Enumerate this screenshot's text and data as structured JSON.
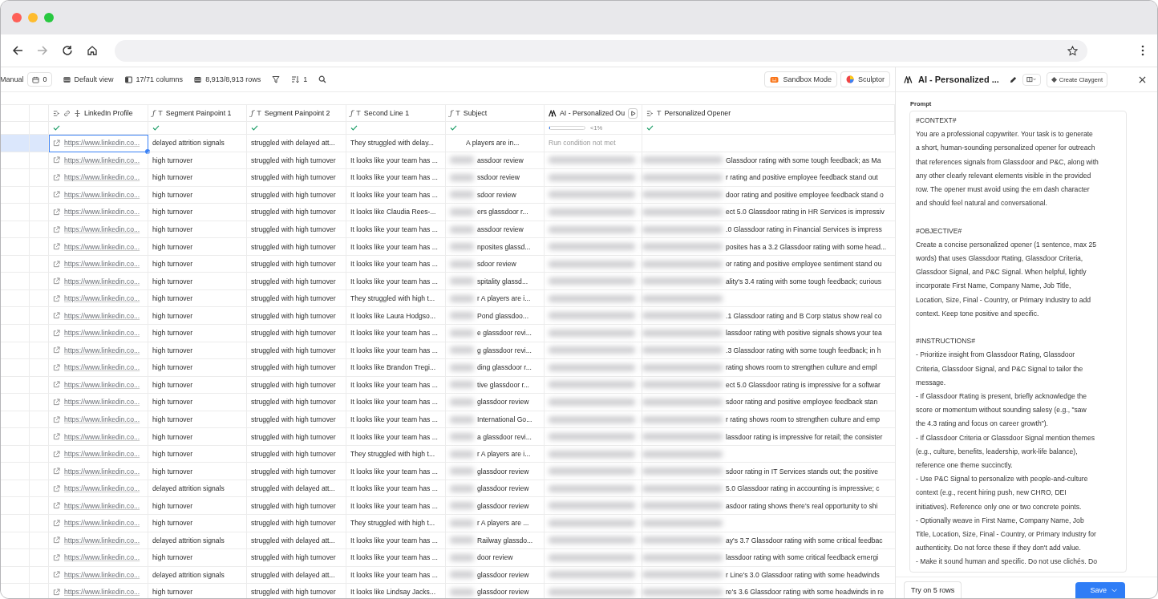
{
  "toolbar": {
    "view_mode": "Manual",
    "count": "0",
    "view": "Default view",
    "columns": "17/71 columns",
    "rows": "8,913/8,913 rows",
    "sort_count": "1",
    "actions": [
      {
        "label": "Sandbox Mode",
        "kind": "sandbox"
      },
      {
        "label": "Sculptor",
        "kind": "sculptor"
      }
    ]
  },
  "table": {
    "columns": [
      {
        "label": "LinkedIn Profile",
        "kind": "url",
        "check": true
      },
      {
        "label": "Segment Painpoint 1",
        "kind": "formula",
        "glyphs": [
          "ƒ",
          "T"
        ],
        "check": true
      },
      {
        "label": "Segment Painpoint 2",
        "kind": "formula",
        "glyphs": [
          "ƒ",
          "T"
        ],
        "check": true
      },
      {
        "label": "Second Line 1",
        "kind": "formula",
        "glyphs": [
          "ƒ",
          "T"
        ],
        "check": true
      },
      {
        "label": "Subject",
        "kind": "formula",
        "glyphs": [
          "ƒ",
          "T"
        ],
        "check": true
      },
      {
        "label": "AI - Personalized Ou",
        "kind": "ai",
        "check": false,
        "progress": {
          "level": 0.01,
          "reading": "<1%"
        }
      },
      {
        "label": "Personalized Opener",
        "kind": "input",
        "glyphs": [
          "T"
        ],
        "check": true
      }
    ],
    "rows": [
      {
        "selected": true,
        "redacted": false,
        "linkedin": "https://www.linkedin.co...",
        "painpoint_1": "delayed attrition signals",
        "painpoint_2": "struggled with delayed att...",
        "second_line": "They struggled with delay...",
        "subject": "A players are in...",
        "ai_output": "Run condition not met"
      },
      {
        "selected": false,
        "redacted": true,
        "linkedin": "https://www.linkedin.co...",
        "painpoint_1": "high turnover",
        "painpoint_2": "struggled with high turnover",
        "second_line": "It looks like your team has ...",
        "subject": "assdoor review",
        "opener": "Glassdoor rating with some tough feedback; as Ma"
      },
      {
        "selected": false,
        "redacted": true,
        "linkedin": "https://www.linkedin.co...",
        "painpoint_1": "high turnover",
        "painpoint_2": "struggled with high turnover",
        "second_line": "It looks like your team has ...",
        "subject": "ssdoor review",
        "opener": "r rating and positive employee feedback stand out"
      },
      {
        "selected": false,
        "redacted": true,
        "linkedin": "https://www.linkedin.co...",
        "painpoint_1": "high turnover",
        "painpoint_2": "struggled with high turnover",
        "second_line": "It looks like your team has ...",
        "subject": "sdoor review",
        "opener": "door rating and positive employee feedback stand o"
      },
      {
        "selected": false,
        "redacted": true,
        "linkedin": "https://www.linkedin.co...",
        "painpoint_1": "high turnover",
        "painpoint_2": "struggled with high turnover",
        "second_line": "It looks like Claudia Rees-...",
        "subject": "ers glassdoor r...",
        "opener": "ect 5.0 Glassdoor rating in HR Services is impressiv"
      },
      {
        "selected": false,
        "redacted": true,
        "linkedin": "https://www.linkedin.co...",
        "painpoint_1": "high turnover",
        "painpoint_2": "struggled with high turnover",
        "second_line": "It looks like your team has ...",
        "subject": "assdoor review",
        "opener": ".0 Glassdoor rating in Financial Services is impress"
      },
      {
        "selected": false,
        "redacted": true,
        "linkedin": "https://www.linkedin.co...",
        "painpoint_1": "high turnover",
        "painpoint_2": "struggled with high turnover",
        "second_line": "It looks like your team has ...",
        "subject": "nposites glassd...",
        "opener": "posites has a 3.2 Glassdoor rating with some head..."
      },
      {
        "selected": false,
        "redacted": true,
        "linkedin": "https://www.linkedin.co...",
        "painpoint_1": "high turnover",
        "painpoint_2": "struggled with high turnover",
        "second_line": "It looks like your team has ...",
        "subject": "sdoor review",
        "opener": "or rating and positive employee sentiment stand ou"
      },
      {
        "selected": false,
        "redacted": true,
        "linkedin": "https://www.linkedin.co...",
        "painpoint_1": "high turnover",
        "painpoint_2": "struggled with high turnover",
        "second_line": "It looks like your team has ...",
        "subject": "spitality glassd...",
        "opener": "ality's 3.4 rating with some tough feedback; curious"
      },
      {
        "selected": false,
        "redacted": true,
        "linkedin": "https://www.linkedin.co...",
        "painpoint_1": "high turnover",
        "painpoint_2": "struggled with high turnover",
        "second_line": "They struggled with high t...",
        "subject": "r A players are i..."
      },
      {
        "selected": false,
        "redacted": true,
        "linkedin": "https://www.linkedin.co...",
        "painpoint_1": "high turnover",
        "painpoint_2": "struggled with high turnover",
        "second_line": "It looks like Laura Hodgso...",
        "subject": "Pond glassdoo...",
        "opener": ".1 Glassdoor rating and B Corp status show real co"
      },
      {
        "selected": false,
        "redacted": true,
        "linkedin": "https://www.linkedin.co...",
        "painpoint_1": "high turnover",
        "painpoint_2": "struggled with high turnover",
        "second_line": "It looks like your team has ...",
        "subject": "e glassdoor revi...",
        "opener": "lassdoor rating with positive signals shows your tea"
      },
      {
        "selected": false,
        "redacted": true,
        "linkedin": "https://www.linkedin.co...",
        "painpoint_1": "high turnover",
        "painpoint_2": "struggled with high turnover",
        "second_line": "It looks like your team has ...",
        "subject": "g glassdoor revi...",
        "opener": ".3 Glassdoor rating with some tough feedback; in h"
      },
      {
        "selected": false,
        "redacted": true,
        "linkedin": "https://www.linkedin.co...",
        "painpoint_1": "high turnover",
        "painpoint_2": "struggled with high turnover",
        "second_line": "It looks like Brandon Tregi...",
        "subject": "ding glassdoor r...",
        "opener": "rating shows room to strengthen culture and empl"
      },
      {
        "selected": false,
        "redacted": true,
        "linkedin": "https://www.linkedin.co...",
        "painpoint_1": "high turnover",
        "painpoint_2": "struggled with high turnover",
        "second_line": "It looks like your team has ...",
        "subject": "tive glassdoor r...",
        "opener": "ect 5.0 Glassdoor rating is impressive for a softwar"
      },
      {
        "selected": false,
        "redacted": true,
        "linkedin": "https://www.linkedin.co...",
        "painpoint_1": "high turnover",
        "painpoint_2": "struggled with high turnover",
        "second_line": "It looks like your team has ...",
        "subject": "glassdoor review",
        "opener": "sdoor rating and positive employee feedback stan"
      },
      {
        "selected": false,
        "redacted": true,
        "linkedin": "https://www.linkedin.co...",
        "painpoint_1": "high turnover",
        "painpoint_2": "struggled with high turnover",
        "second_line": "It looks like your team has ...",
        "subject": "International Go...",
        "opener": "r rating shows room to strengthen culture and emp"
      },
      {
        "selected": false,
        "redacted": true,
        "linkedin": "https://www.linkedin.co...",
        "painpoint_1": "high turnover",
        "painpoint_2": "struggled with high turnover",
        "second_line": "It looks like your team has ...",
        "subject": "a glassdoor revi...",
        "opener": "lassdoor rating is impressive for retail; the consister"
      },
      {
        "selected": false,
        "redacted": true,
        "linkedin": "https://www.linkedin.co...",
        "painpoint_1": "high turnover",
        "painpoint_2": "struggled with high turnover",
        "second_line": "They struggled with high t...",
        "subject": "r A players are i..."
      },
      {
        "selected": false,
        "redacted": true,
        "linkedin": "https://www.linkedin.co...",
        "painpoint_1": "high turnover",
        "painpoint_2": "struggled with high turnover",
        "second_line": "It looks like your team has ...",
        "subject": "glassdoor review",
        "opener": "sdoor rating in IT Services stands out; the positive"
      },
      {
        "selected": false,
        "redacted": true,
        "linkedin": "https://www.linkedin.co...",
        "painpoint_1": "delayed attrition signals",
        "painpoint_2": "struggled with delayed att...",
        "second_line": "It looks like your team has ...",
        "subject": "glassdoor review",
        "opener": "5.0 Glassdoor rating in accounting is impressive; c"
      },
      {
        "selected": false,
        "redacted": true,
        "linkedin": "https://www.linkedin.co...",
        "painpoint_1": "high turnover",
        "painpoint_2": "struggled with high turnover",
        "second_line": "It looks like your team has ...",
        "subject": "glassdoor review",
        "opener": "asdoor rating shows there's real opportunity to shi"
      },
      {
        "selected": false,
        "redacted": true,
        "linkedin": "https://www.linkedin.co...",
        "painpoint_1": "high turnover",
        "painpoint_2": "struggled with high turnover",
        "second_line": "They struggled with high t...",
        "subject": "r A players are ..."
      },
      {
        "selected": false,
        "redacted": true,
        "linkedin": "https://www.linkedin.co...",
        "painpoint_1": "delayed attrition signals",
        "painpoint_2": "struggled with delayed att...",
        "second_line": "It looks like your team has ...",
        "subject": "Railway glassdo...",
        "opener": "ay's 3.7 Glassdoor rating with some critical feedbac"
      },
      {
        "selected": false,
        "redacted": true,
        "linkedin": "https://www.linkedin.co...",
        "painpoint_1": "high turnover",
        "painpoint_2": "struggled with high turnover",
        "second_line": "It looks like your team has ...",
        "subject": "door review",
        "opener": "lassdoor rating with some critical feedback emergi"
      },
      {
        "selected": false,
        "redacted": true,
        "linkedin": "https://www.linkedin.co...",
        "painpoint_1": "delayed attrition signals",
        "painpoint_2": "struggled with delayed att...",
        "second_line": "It looks like your team has ...",
        "subject": "glassdoor review",
        "opener": "r Line's 3.0 Glassdoor rating with some headwinds"
      },
      {
        "selected": false,
        "redacted": true,
        "linkedin": "https://www.linkedin.co...",
        "painpoint_1": "high turnover",
        "painpoint_2": "struggled with high turnover",
        "second_line": "It looks like Lindsay Jacks...",
        "subject": "glassdoor review",
        "opener": "re's 3.6 Glassdoor rating with some headwinds in re"
      }
    ]
  },
  "panel": {
    "title": "AI - Personalized ...",
    "action": "Create Claygent",
    "prompt_label": "Prompt",
    "prompt_sections": [
      {
        "heading": "#CONTEXT#",
        "lines": [
          "You are a professional copywriter. Your task is to generate",
          "a short, human-sounding personalized opener for outreach",
          "that references signals from Glassdoor and P&C, along with",
          "any other clearly relevant elements visible in the provided",
          "row. The opener must avoid using the em dash character",
          "and should feel natural and conversational."
        ]
      },
      {
        "heading": "#OBJECTIVE#",
        "lines": [
          "Create a concise personalized opener (1 sentence, max 25",
          "words) that uses Glassdoor Rating, Glassdoor Criteria,",
          "Glassdoor Signal, and P&C Signal. When helpful, lightly",
          "incorporate First Name, Company Name, Job Title,",
          "Location, Size, Final - Country, or Primary Industry to add",
          "context. Keep tone positive and specific."
        ]
      },
      {
        "heading": "#INSTRUCTIONS#",
        "lines": [
          "- Prioritize insight from Glassdoor Rating, Glassdoor",
          "Criteria, Glassdoor Signal, and P&C Signal to tailor the",
          "message.",
          "- If Glassdoor Rating is present, briefly acknowledge the",
          "score or momentum without sounding salesy (e.g., \"saw",
          "the 4.3 rating and focus on career growth\").",
          "- If Glassdoor Criteria or Glassdoor Signal mention themes",
          "(e.g., culture, benefits, leadership, work-life balance),",
          "reference one theme succinctly.",
          "- Use P&C Signal to personalize with people-and-culture",
          "context (e.g., recent hiring push, new CHRO, DEI",
          "initiatives). Reference only one or two concrete points.",
          "- Optionally weave in First Name, Company Name, Job",
          "Title, Location, Size, Final - Country, or Primary Industry for",
          "authenticity. Do not force these if they don't add value.",
          "- Make it sound human and specific. Do not use clichés. Do"
        ]
      }
    ],
    "footer": {
      "trial": "Try on 5 rows",
      "save": "Save"
    }
  }
}
